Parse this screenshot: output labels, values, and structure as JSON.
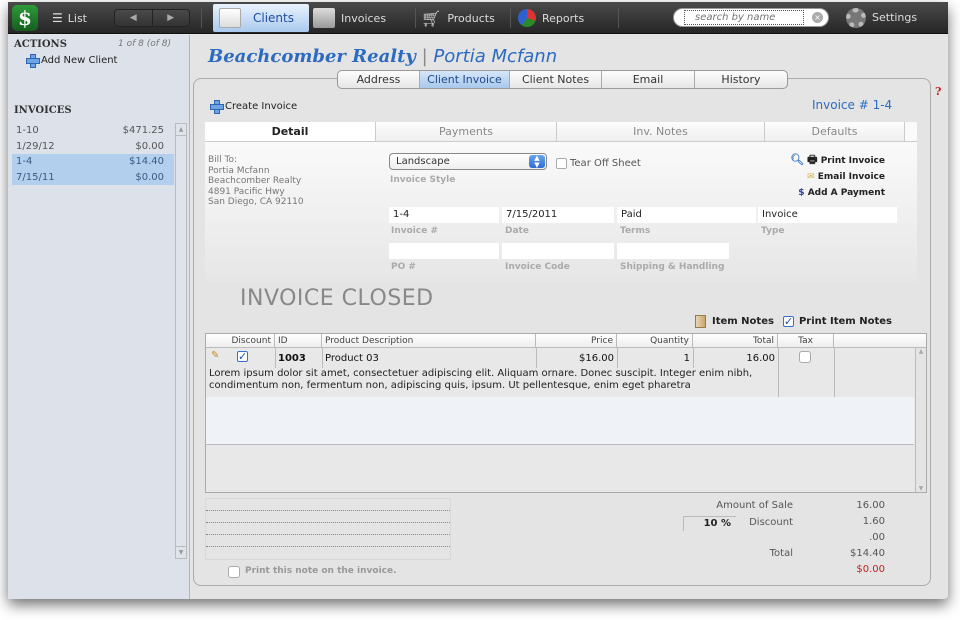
{
  "toolbar": {
    "list_label": "List",
    "tabs": [
      {
        "label": "Clients",
        "active": true
      },
      {
        "label": "Invoices",
        "active": false
      },
      {
        "label": "Products",
        "active": false
      },
      {
        "label": "Reports",
        "active": false
      }
    ],
    "search_placeholder": "search by name",
    "settings_label": "Settings"
  },
  "sidebar": {
    "actions_heading": "ACTIONS",
    "record_count": "1 of 8 (of 8)",
    "add_client_label": "Add New Client",
    "invoices_heading": "INVOICES",
    "invoices": [
      {
        "number": "1-10",
        "amount": "$471.25",
        "date": "1/29/12",
        "balance": "$0.00",
        "selected": false
      },
      {
        "number": "1-4",
        "amount": "$14.40",
        "date": "7/15/11",
        "balance": "$0.00",
        "selected": true
      }
    ]
  },
  "header": {
    "company": "Beachcomber Realty",
    "separator": "|",
    "contact": "Portia Mcfann"
  },
  "client_tabs": [
    "Address",
    "Client Invoice",
    "Client Notes",
    "Email",
    "History"
  ],
  "client_tab_active": "Client Invoice",
  "help_glyph": "?",
  "create_invoice_label": "Create Invoice",
  "invoice_number_label": "Invoice # 1-4",
  "sub_tabs": [
    "Detail",
    "Payments",
    "Inv. Notes",
    "Defaults"
  ],
  "bill_to": {
    "label": "Bill To:",
    "lines": [
      "Portia Mcfann",
      "Beachcomber Realty",
      "4891 Pacific Hwy",
      "San Diego, CA 92110"
    ]
  },
  "invoice_style": {
    "value": "Landscape",
    "label": "Invoice Style"
  },
  "tear_off_label": "Tear Off Sheet",
  "invoice_actions": {
    "print": "Print Invoice",
    "email": "Email Invoice",
    "payment": "Add A Payment"
  },
  "fields": {
    "invoice_no": {
      "value": "1-4",
      "label": "Invoice #"
    },
    "date": {
      "value": "7/15/2011",
      "label": "Date"
    },
    "terms": {
      "value": "Paid",
      "label": "Terms"
    },
    "type": {
      "value": "Invoice",
      "label": "Type"
    },
    "po": {
      "value": "",
      "label": "PO #"
    },
    "code": {
      "value": "",
      "label": "Invoice Code"
    },
    "shipping": {
      "value": "",
      "label": "Shipping & Handling"
    }
  },
  "status_text": "INVOICE CLOSED",
  "item_notes_label": "Item Notes",
  "print_item_notes_label": "Print Item Notes",
  "line_items": {
    "headers": [
      "Discount",
      "ID",
      "Product Description",
      "Price",
      "Quantity",
      "Total",
      "Tax"
    ],
    "rows": [
      {
        "discount_checked": true,
        "id": "1003",
        "description": "Product 03",
        "price": "$16.00",
        "quantity": "1",
        "total": "16.00",
        "tax_checked": false,
        "notes": "Lorem ipsum dolor sit amet, consectetuer adipiscing elit. Aliquam ornare. Donec suscipit. Integer enim nibh, condimentum non, fermentum non, adipiscing quis, ipsum. Ut pellentesque, enim eget pharetra"
      }
    ]
  },
  "print_note_label": "Print this note on the invoice.",
  "totals": {
    "amount_of_sale_label": "Amount of Sale",
    "amount_of_sale": "16.00",
    "discount_pct": "10 %",
    "discount_label": "Discount",
    "discount": "1.60",
    "extra": ".00",
    "total_label": "Total",
    "total": "$14.40",
    "balance": "$0.00"
  },
  "colors": {
    "accent": "#2c6bc0",
    "selection": "#b3cfee",
    "balance_red": "#c0221e"
  }
}
